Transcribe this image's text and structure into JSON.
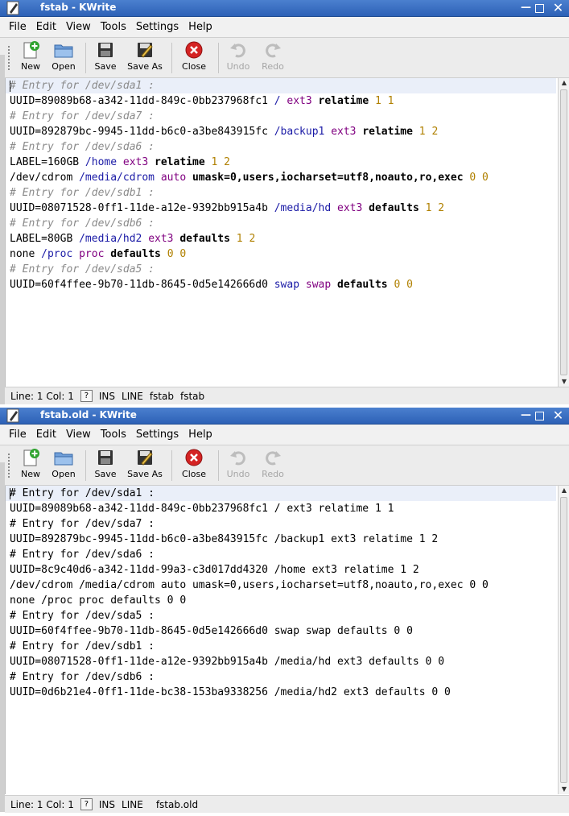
{
  "window1": {
    "title": "fstab - KWrite",
    "menu": [
      "File",
      "Edit",
      "View",
      "Tools",
      "Settings",
      "Help"
    ],
    "toolbar": {
      "new": "New",
      "open": "Open",
      "save": "Save",
      "save_as": "Save As",
      "close": "Close",
      "undo": "Undo",
      "redo": "Redo"
    },
    "status": {
      "position": "Line: 1 Col: 1",
      "help_glyph": "?",
      "mode": "INS",
      "selection": "LINE",
      "file_type": "fstab",
      "file_name": "fstab"
    },
    "lines": [
      [
        [
          "# Entry for /dev/sda1 :",
          "comment"
        ]
      ],
      [
        [
          "UUID=89089b68-a342-11dd-849c-0bb237968fc1 ",
          ""
        ],
        [
          "/",
          "path"
        ],
        [
          " ",
          ""
        ],
        [
          "ext3",
          "type"
        ],
        [
          " ",
          ""
        ],
        [
          "relatime",
          "opt"
        ],
        [
          " ",
          ""
        ],
        [
          "1",
          "num"
        ],
        [
          " ",
          ""
        ],
        [
          "1",
          "num"
        ]
      ],
      [
        [
          "# Entry for /dev/sda7 :",
          "comment"
        ]
      ],
      [
        [
          "UUID=892879bc-9945-11dd-b6c0-a3be843915fc ",
          ""
        ],
        [
          "/backup1",
          "path"
        ],
        [
          " ",
          ""
        ],
        [
          "ext3",
          "type"
        ],
        [
          " ",
          ""
        ],
        [
          "relatime",
          "opt"
        ],
        [
          " ",
          ""
        ],
        [
          "1",
          "num"
        ],
        [
          " ",
          ""
        ],
        [
          "2",
          "num"
        ]
      ],
      [
        [
          "# Entry for /dev/sda6 :",
          "comment"
        ]
      ],
      [
        [
          "LABEL=160GB ",
          ""
        ],
        [
          "/home",
          "path"
        ],
        [
          " ",
          ""
        ],
        [
          "ext3",
          "type"
        ],
        [
          " ",
          ""
        ],
        [
          "relatime",
          "opt"
        ],
        [
          " ",
          ""
        ],
        [
          "1",
          "num"
        ],
        [
          " ",
          ""
        ],
        [
          "2",
          "num"
        ]
      ],
      [
        [
          "/dev/cdrom ",
          ""
        ],
        [
          "/media/cdrom",
          "path"
        ],
        [
          " ",
          ""
        ],
        [
          "auto",
          "type"
        ],
        [
          " ",
          ""
        ],
        [
          "umask=0,users,iocharset=utf8,noauto,ro,exec",
          "opt"
        ],
        [
          " ",
          ""
        ],
        [
          "0",
          "num"
        ],
        [
          " ",
          ""
        ],
        [
          "0",
          "num"
        ]
      ],
      [
        [
          "# Entry for /dev/sdb1 :",
          "comment"
        ]
      ],
      [
        [
          "UUID=08071528-0ff1-11de-a12e-9392bb915a4b ",
          ""
        ],
        [
          "/media/hd",
          "path"
        ],
        [
          " ",
          ""
        ],
        [
          "ext3",
          "type"
        ],
        [
          " ",
          ""
        ],
        [
          "defaults",
          "opt"
        ],
        [
          " ",
          ""
        ],
        [
          "1",
          "num"
        ],
        [
          " ",
          ""
        ],
        [
          "2",
          "num"
        ]
      ],
      [
        [
          "# Entry for /dev/sdb6 :",
          "comment"
        ]
      ],
      [
        [
          "LABEL=80GB ",
          ""
        ],
        [
          "/media/hd2",
          "path"
        ],
        [
          " ",
          ""
        ],
        [
          "ext3",
          "type"
        ],
        [
          " ",
          ""
        ],
        [
          "defaults",
          "opt"
        ],
        [
          " ",
          ""
        ],
        [
          "1",
          "num"
        ],
        [
          " ",
          ""
        ],
        [
          "2",
          "num"
        ]
      ],
      [
        [
          "none ",
          ""
        ],
        [
          "/proc",
          "path"
        ],
        [
          " ",
          ""
        ],
        [
          "proc",
          "type"
        ],
        [
          " ",
          ""
        ],
        [
          "defaults",
          "opt"
        ],
        [
          " ",
          ""
        ],
        [
          "0",
          "num"
        ],
        [
          " ",
          ""
        ],
        [
          "0",
          "num"
        ]
      ],
      [
        [
          "# Entry for /dev/sda5 :",
          "comment"
        ]
      ],
      [
        [
          "UUID=60f4ffee-9b70-11db-8645-0d5e142666d0 ",
          ""
        ],
        [
          "swap",
          "path"
        ],
        [
          " ",
          ""
        ],
        [
          "swap",
          "type"
        ],
        [
          " ",
          ""
        ],
        [
          "defaults",
          "opt"
        ],
        [
          " ",
          ""
        ],
        [
          "0",
          "num"
        ],
        [
          " ",
          ""
        ],
        [
          "0",
          "num"
        ]
      ]
    ]
  },
  "window2": {
    "title": "fstab.old - KWrite",
    "menu": [
      "File",
      "Edit",
      "View",
      "Tools",
      "Settings",
      "Help"
    ],
    "toolbar": {
      "new": "New",
      "open": "Open",
      "save": "Save",
      "save_as": "Save As",
      "close": "Close",
      "undo": "Undo",
      "redo": "Redo"
    },
    "status": {
      "position": "Line: 1 Col: 1",
      "help_glyph": "?",
      "mode": "INS",
      "selection": "LINE",
      "file_type": "",
      "file_name": "fstab.old"
    },
    "lines": [
      [
        [
          "# Entry for /dev/sda1 :",
          ""
        ]
      ],
      [
        [
          "UUID=89089b68-a342-11dd-849c-0bb237968fc1 / ext3 relatime 1 1",
          ""
        ]
      ],
      [
        [
          "# Entry for /dev/sda7 :",
          ""
        ]
      ],
      [
        [
          "UUID=892879bc-9945-11dd-b6c0-a3be843915fc /backup1 ext3 relatime 1 2",
          ""
        ]
      ],
      [
        [
          "# Entry for /dev/sda6 :",
          ""
        ]
      ],
      [
        [
          "UUID=8c9c40d6-a342-11dd-99a3-c3d017dd4320 /home ext3 relatime 1 2",
          ""
        ]
      ],
      [
        [
          "/dev/cdrom /media/cdrom auto umask=0,users,iocharset=utf8,noauto,ro,exec 0 0",
          ""
        ]
      ],
      [
        [
          "none /proc proc defaults 0 0",
          ""
        ]
      ],
      [
        [
          "# Entry for /dev/sda5 :",
          ""
        ]
      ],
      [
        [
          "UUID=60f4ffee-9b70-11db-8645-0d5e142666d0 swap swap defaults 0 0",
          ""
        ]
      ],
      [
        [
          "# Entry for /dev/sdb1 :",
          ""
        ]
      ],
      [
        [
          "UUID=08071528-0ff1-11de-a12e-9392bb915a4b /media/hd ext3 defaults 0 0",
          ""
        ]
      ],
      [
        [
          "# Entry for /dev/sdb6 :",
          ""
        ]
      ],
      [
        [
          "UUID=0d6b21e4-0ff1-11de-bc38-153ba9338256 /media/hd2 ext3 defaults 0 0",
          ""
        ]
      ]
    ]
  }
}
